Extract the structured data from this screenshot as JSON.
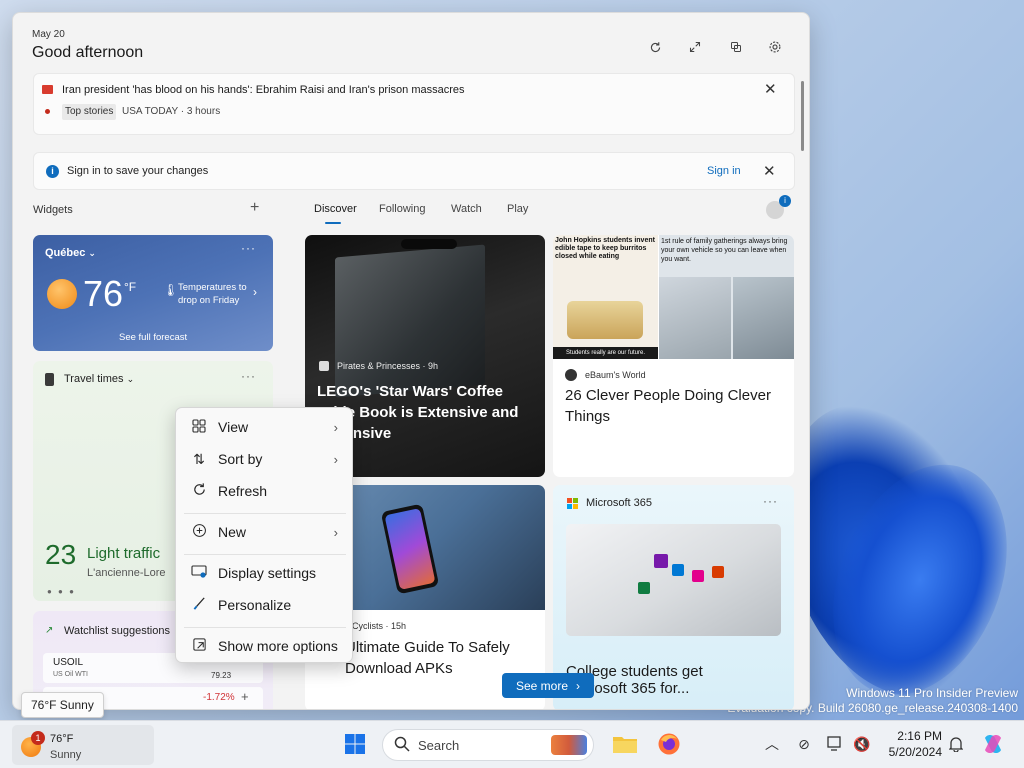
{
  "panel": {
    "date": "May 20",
    "greeting": "Good afternoon",
    "header_icons": [
      "refresh-icon",
      "expand-icon",
      "pin-icon",
      "settings-icon"
    ]
  },
  "top_story": {
    "headline": "Iran president 'has blood on his hands': Ebrahim Raisi and Iran's prison massacres",
    "tag": "Top stories",
    "source": "USA TODAY · 3 hours"
  },
  "signin_bar": {
    "message": "Sign in to save your changes",
    "link": "Sign in"
  },
  "widgets_header": {
    "title": "Widgets",
    "add": "+"
  },
  "tabs": [
    "Discover",
    "Following",
    "Watch",
    "Play"
  ],
  "weather_widget": {
    "location": "Québec",
    "temp": "76",
    "unit": "°F",
    "alert": "Temperatures to drop on Friday",
    "link": "See full forecast"
  },
  "travel_widget": {
    "title": "Travel times",
    "minutes": "23",
    "minutes_unit": "",
    "status": "Light traffic",
    "route": "L'ancienne-Lore"
  },
  "watchlist_widget": {
    "title": "Watchlist suggestions",
    "rows": [
      {
        "symbol": "USOIL",
        "name": "US Oil WTI",
        "value": "79.23",
        "change": "-1.72%"
      }
    ]
  },
  "feed": {
    "card1": {
      "source": "Pirates & Princesses · 9h",
      "title_line1": "LEGO's 'Star Wars' Coffee",
      "title_line2": "Table Book is Extensive and",
      "title_line3": "Expensive"
    },
    "card2": {
      "image_caption": "John Hopkins students invent edible tape to keep burritos closed while eating",
      "image_caption2": "Students really are our future.",
      "image_caption3": "1st rule of family gatherings always bring your own vehicle so you can leave when you want.",
      "source": "eBaum's World",
      "title": "26 Clever People Doing Clever Things"
    },
    "card3": {
      "source": "y Cyclists · 15h",
      "title_line1": "Ultimate Guide To Safely",
      "title_line2": "Download APKs"
    },
    "card4": {
      "source": "Microsoft 365",
      "title_line1": "College students get",
      "title_line2": "Microsoft 365 for..."
    },
    "see_more": "See more"
  },
  "context_menu": {
    "items": [
      {
        "label": "View",
        "icon": "view-grid-icon",
        "submenu": true
      },
      {
        "label": "Sort by",
        "icon": "sort-icon",
        "submenu": true
      },
      {
        "label": "Refresh",
        "icon": "refresh-icon",
        "submenu": false
      },
      {
        "label": "New",
        "icon": "new-plus-icon",
        "submenu": true
      },
      {
        "label": "Display settings",
        "icon": "display-icon",
        "submenu": false
      },
      {
        "label": "Personalize",
        "icon": "brush-icon",
        "submenu": false
      },
      {
        "label": "Show more options",
        "icon": "more-options-icon",
        "submenu": false
      }
    ]
  },
  "desktop": {
    "watermark_line1": "Windows 11 Pro Insider Preview",
    "watermark_line2": "Evaluation copy. Build 26080.ge_release.240308-1400"
  },
  "taskbar": {
    "tooltip": "76°F Sunny",
    "weather_temp": "76°F",
    "weather_cond": "Sunny",
    "badge": "1",
    "search_placeholder": "Search",
    "clock_time": "2:16 PM",
    "clock_date": "5/20/2024"
  },
  "colors": {
    "accent": "#0f6cbd",
    "panel_bg": "#f3f3f3",
    "weather_bg": "#4d72b6",
    "travel_green": "#1e6b2c",
    "negative": "#d13438"
  }
}
